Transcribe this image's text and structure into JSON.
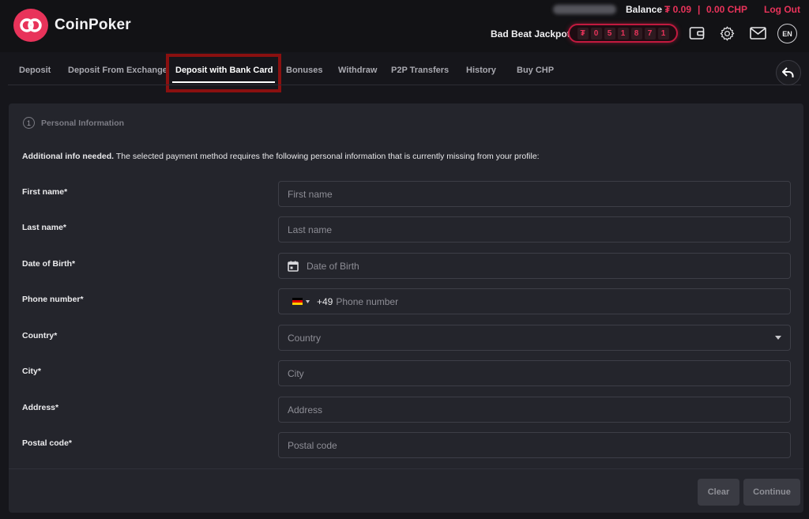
{
  "app": {
    "logo_text": "CoinPoker"
  },
  "header": {
    "balance_label": "Balance",
    "balance_value": "₮ 0.09",
    "balance_separator": "|",
    "balance_chp": "0.00 CHP",
    "logout_label": "Log Out",
    "jackpot_label": "Bad Beat Jackpot",
    "jackpot_digits": [
      "₮",
      "0",
      "5",
      "1",
      "8",
      "7",
      "1"
    ],
    "language": "EN",
    "icons": [
      "wallet-icon",
      "gear-icon",
      "mail-icon"
    ]
  },
  "tabs": [
    {
      "label": "Deposit"
    },
    {
      "label": "Deposit From Exchange"
    },
    {
      "label": "Deposit with Bank Card",
      "active": true
    },
    {
      "label": "Bonuses"
    },
    {
      "label": "Withdraw"
    },
    {
      "label": "P2P Transfers"
    },
    {
      "label": "History"
    },
    {
      "label": "Buy CHP"
    }
  ],
  "form": {
    "step_number": "1",
    "step_label": "Personal Information",
    "notice_bold": "Additional info needed.",
    "notice_text": " The selected payment method requires the following personal information that is currently missing from your profile:",
    "fields": {
      "first_name": {
        "label": "First name*",
        "placeholder": "First name",
        "value": ""
      },
      "last_name": {
        "label": "Last name*",
        "placeholder": "Last name",
        "value": ""
      },
      "dob": {
        "label": "Date of Birth*",
        "placeholder": "Date of Birth"
      },
      "phone": {
        "label": "Phone number*",
        "country_code": "+49",
        "placeholder": "Phone number",
        "flag": "de"
      },
      "country": {
        "label": "Country*",
        "placeholder": "Country"
      },
      "city": {
        "label": "City*",
        "placeholder": "City",
        "value": ""
      },
      "address": {
        "label": "Address*",
        "placeholder": "Address",
        "value": ""
      },
      "postal_code": {
        "label": "Postal code*",
        "placeholder": "Postal code",
        "value": ""
      }
    },
    "clear_label": "Clear",
    "continue_label": "Continue"
  },
  "colors": {
    "accent": "#e8335a",
    "highlight_border": "#8a1010",
    "panel": "#24252c"
  }
}
